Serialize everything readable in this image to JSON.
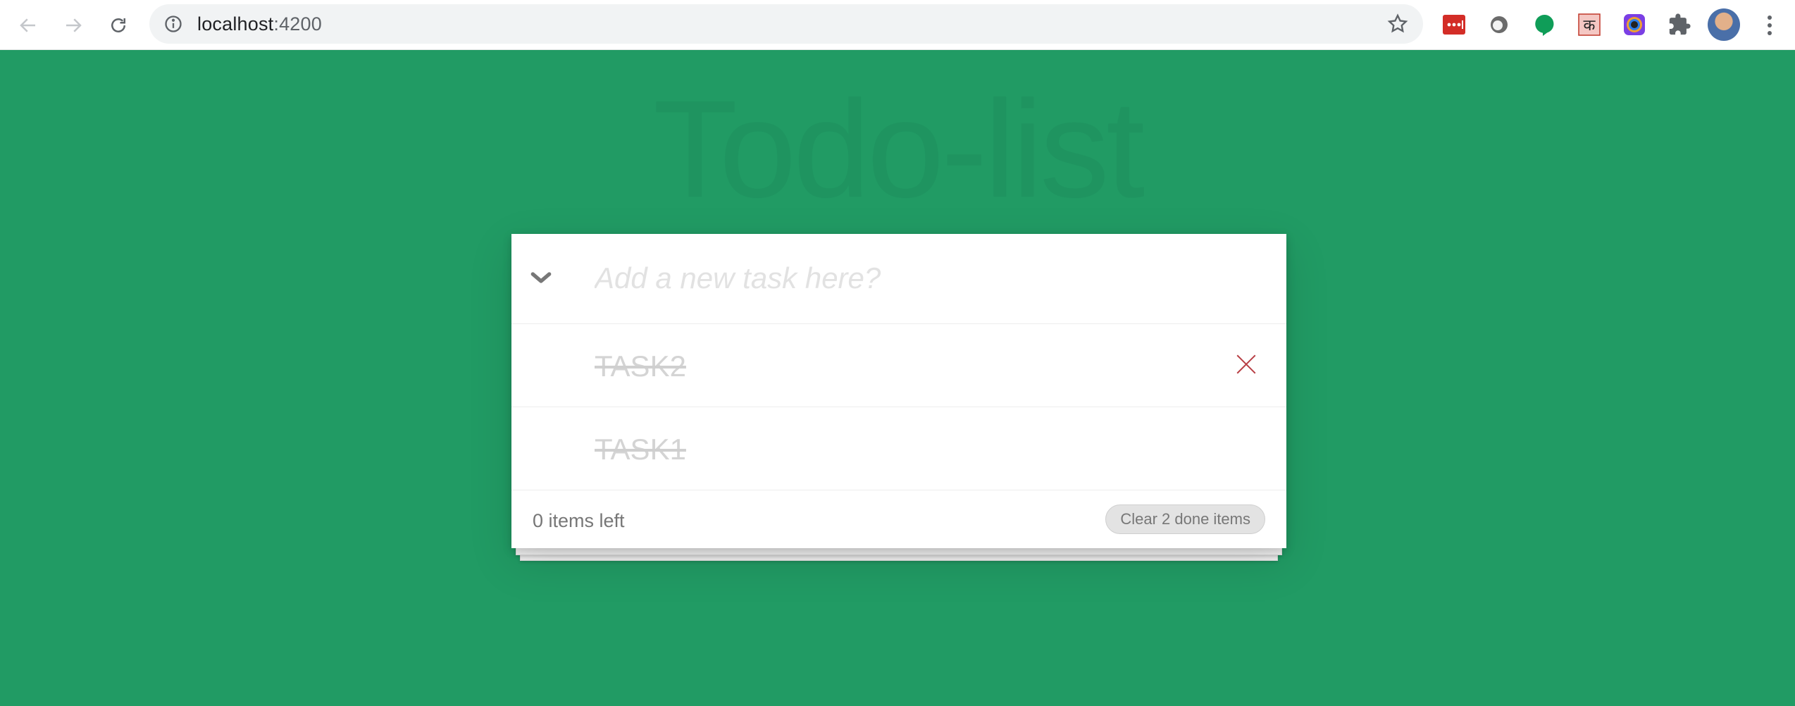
{
  "browser": {
    "url_host": "localhost",
    "url_port": ":4200",
    "extensions": [
      "lastpass-icon",
      "loom-icon",
      "hangouts-icon",
      "hindi-ka-icon",
      "color-picker-icon",
      "extensions-puzzle-icon"
    ]
  },
  "app": {
    "title": "Todo-list",
    "new_task_placeholder": "Add a new task here?",
    "todos": [
      {
        "text": "TASK2",
        "done": true
      },
      {
        "text": "TASK1",
        "done": true
      }
    ],
    "footer": {
      "items_left": "0 items left",
      "clear_label": "Clear 2 done items"
    }
  },
  "colors": {
    "background": "#219b64",
    "destroy": "#b83f45"
  }
}
